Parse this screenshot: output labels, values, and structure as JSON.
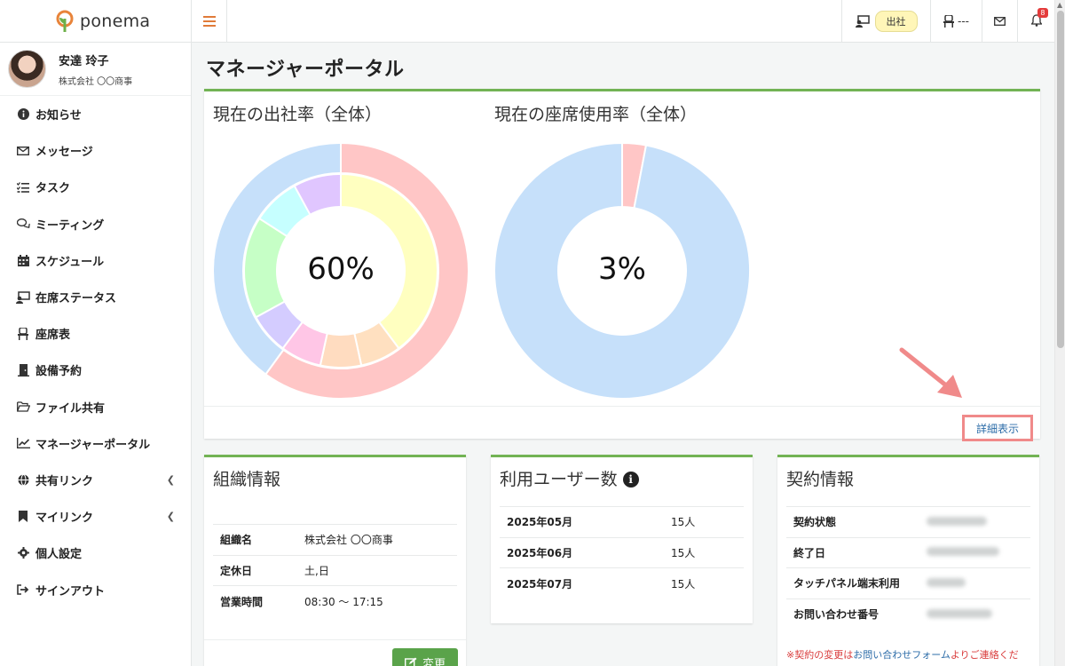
{
  "app": {
    "brand": "ponema",
    "icons": {
      "logo": "leaf-logo-icon",
      "menu": "hamburger-icon"
    }
  },
  "topbar": {
    "attendance_label": "出社",
    "seat_label": "---",
    "notification_count": "8",
    "icons": [
      "desk-person-icon",
      "chair-icon",
      "mail-icon",
      "bell-icon"
    ]
  },
  "user": {
    "name": "安達 玲子",
    "org": "株式会社 〇〇商事"
  },
  "sidebar": {
    "items": [
      {
        "label": "お知らせ",
        "icon": "info-circle-icon"
      },
      {
        "label": "メッセージ",
        "icon": "envelope-icon"
      },
      {
        "label": "タスク",
        "icon": "list-check-icon"
      },
      {
        "label": "ミーティング",
        "icon": "chat-bubbles-icon"
      },
      {
        "label": "スケジュール",
        "icon": "calendar-icon"
      },
      {
        "label": "在席ステータス",
        "icon": "desk-person-icon"
      },
      {
        "label": "座席表",
        "icon": "chair-icon"
      },
      {
        "label": "設備予約",
        "icon": "door-icon"
      },
      {
        "label": "ファイル共有",
        "icon": "folder-icon"
      },
      {
        "label": "マネージャーポータル",
        "icon": "line-chart-icon"
      },
      {
        "label": "共有リンク",
        "icon": "globe-icon"
      },
      {
        "label": "マイリンク",
        "icon": "bookmark-icon"
      },
      {
        "label": "個人設定",
        "icon": "gear-icon"
      },
      {
        "label": "サインアウト",
        "icon": "sign-out-icon"
      }
    ]
  },
  "page": {
    "title": "マネージャーポータル"
  },
  "overview": {
    "attendance_title": "現在の出社率（全体）",
    "attendance_value": "60%",
    "seat_title": "現在の座席使用率（全体）",
    "seat_value": "3%",
    "detail_link": "詳細表示"
  },
  "chart_data": [
    {
      "type": "pie",
      "title": "現在の出社率（全体）",
      "center_label": "60%",
      "outer_ring": {
        "values": [
          60,
          40
        ],
        "colors": [
          "#ffc6c6",
          "#c6e0fa"
        ]
      },
      "inner_ring": {
        "values": [
          35,
          6,
          6,
          6,
          6,
          15,
          7,
          7
        ],
        "colors": [
          "#ffffc0",
          "#ffe0c0",
          "#ffdcc0",
          "#ffc6e6",
          "#d4ccff",
          "#c6ffc6",
          "#c6ffff",
          "#e0c6ff"
        ]
      }
    },
    {
      "type": "pie",
      "title": "現在の座席使用率（全体）",
      "center_label": "3%",
      "values": [
        3,
        97
      ],
      "colors": [
        "#ffc6c6",
        "#c6e0fa"
      ]
    }
  ],
  "org": {
    "title": "組織情報",
    "rows": [
      {
        "key": "組織名",
        "value": "株式会社 〇〇商事"
      },
      {
        "key": "定休日",
        "value": "土,日"
      },
      {
        "key": "営業時間",
        "value": "08:30 〜 17:15"
      }
    ],
    "change_button": "変更",
    "change_icon": "edit-icon"
  },
  "users": {
    "title": "利用ユーザー数",
    "info_icon": "info-circle-icon",
    "rows": [
      {
        "month": "2025年05月",
        "count": "15人"
      },
      {
        "month": "2025年06月",
        "count": "15人"
      },
      {
        "month": "2025年07月",
        "count": "15人"
      }
    ]
  },
  "contract": {
    "title": "契約情報",
    "rows": [
      {
        "key": "契約状態"
      },
      {
        "key": "終了日"
      },
      {
        "key": "タッチパネル端末利用"
      },
      {
        "key": "お問い合わせ番号"
      }
    ],
    "note_prefix": "※契約の変更は",
    "note_link": "お問い合わせフォーム",
    "note_suffix": "よりご連絡くだ"
  }
}
